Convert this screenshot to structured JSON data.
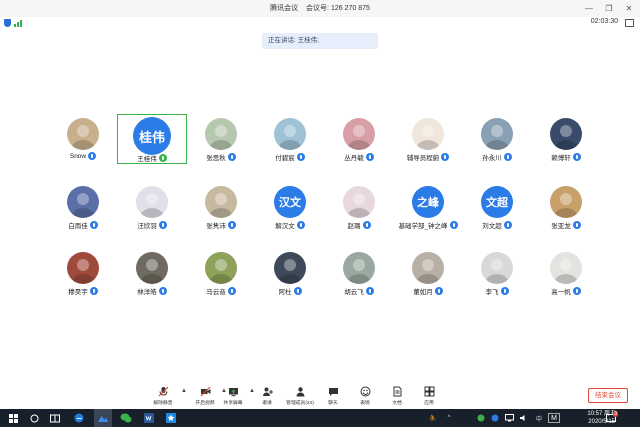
{
  "window": {
    "title": "腾讯会议",
    "meeting_id_label": "会议号:",
    "meeting_id": "126 270 875",
    "controls": [
      "—",
      "❐",
      "✕"
    ]
  },
  "infobar": {
    "timer": "02:03:30"
  },
  "speaking": {
    "label": "正在讲话: 王桂伟;"
  },
  "participants": [
    {
      "name": "Snow",
      "avatar": "photo",
      "color": "#c9b08d",
      "mic": "on"
    },
    {
      "name": "王桂伟",
      "avatar": "text",
      "avatar_text": "桂伟",
      "color": "#2b7ce6",
      "mic": "speaking",
      "active": true
    },
    {
      "name": "张思秋",
      "avatar": "photo",
      "color": "#b7c8b0",
      "mic": "on"
    },
    {
      "name": "付碧宸",
      "avatar": "photo",
      "color": "#9fc2d6",
      "mic": "on"
    },
    {
      "name": "丛丹毓",
      "avatar": "photo",
      "color": "#d8a0a6",
      "mic": "on"
    },
    {
      "name": "辅导员程蔚",
      "avatar": "photo",
      "color": "#f0e6dc",
      "mic": "on"
    },
    {
      "name": "孙永川",
      "avatar": "photo",
      "color": "#8aa0b4",
      "mic": "on"
    },
    {
      "name": "赖博轩",
      "avatar": "photo",
      "color": "#3a4a6a",
      "mic": "on"
    },
    {
      "name": "白雨佳",
      "avatar": "photo",
      "color": "#5a6fa8",
      "mic": "on"
    },
    {
      "name": "汪欣羽",
      "avatar": "photo",
      "color": "#dfe0e8",
      "mic": "on"
    },
    {
      "name": "张隽沛",
      "avatar": "photo",
      "color": "#c7b9a0",
      "mic": "on"
    },
    {
      "name": "解汉文",
      "avatar": "text",
      "avatar_text": "汉文",
      "color": "#2b7ce6",
      "mic": "on"
    },
    {
      "name": "赵璐",
      "avatar": "photo",
      "color": "#e8d8dc",
      "mic": "on"
    },
    {
      "name": "基础学部_钟之峰",
      "avatar": "text",
      "avatar_text": "之峰",
      "color": "#2b7ce6",
      "mic": "on"
    },
    {
      "name": "刘文超",
      "avatar": "text",
      "avatar_text": "文超",
      "color": "#2b7ce6",
      "mic": "on"
    },
    {
      "name": "张亚龙",
      "avatar": "photo",
      "color": "#c8a16a",
      "mic": "on"
    },
    {
      "name": "穆昊宇",
      "avatar": "photo",
      "color": "#a04a3c",
      "mic": "on"
    },
    {
      "name": "林洋皓",
      "avatar": "photo",
      "color": "#6e6a60",
      "mic": "on"
    },
    {
      "name": "马云音",
      "avatar": "photo",
      "color": "#8fa25a",
      "mic": "on"
    },
    {
      "name": "阿杜",
      "avatar": "photo",
      "color": "#3e4a5a",
      "mic": "on"
    },
    {
      "name": "胡云飞",
      "avatar": "photo",
      "color": "#9aa9a0",
      "mic": "on"
    },
    {
      "name": "董如月",
      "avatar": "photo",
      "color": "#b8b0a4",
      "mic": "on"
    },
    {
      "name": "李飞",
      "avatar": "photo",
      "color": "#d8d8d8",
      "mic": "on"
    },
    {
      "name": "高一帆",
      "avatar": "photo",
      "color": "#e2e4e0",
      "mic": "on"
    }
  ],
  "toolbar": {
    "items": [
      {
        "label": "解除静音",
        "icon": "mic-muted-icon"
      },
      {
        "label": "开启视频",
        "icon": "video-off-icon"
      },
      {
        "label": "共享屏幕",
        "icon": "share-screen-icon"
      },
      {
        "label": "邀请",
        "icon": "invite-icon"
      },
      {
        "label": "管理成员(24)",
        "icon": "members-icon"
      },
      {
        "label": "聊天",
        "icon": "chat-icon"
      },
      {
        "label": "表情",
        "icon": "emoji-icon"
      },
      {
        "label": "文档",
        "icon": "document-icon"
      },
      {
        "label": "应用",
        "icon": "apps-icon"
      }
    ],
    "end_meeting": "结束会议"
  },
  "taskbar": {
    "time": "10:57 周五",
    "date": "2020/5/15",
    "input_method": "M",
    "lang": "中",
    "notification_count": "3"
  }
}
